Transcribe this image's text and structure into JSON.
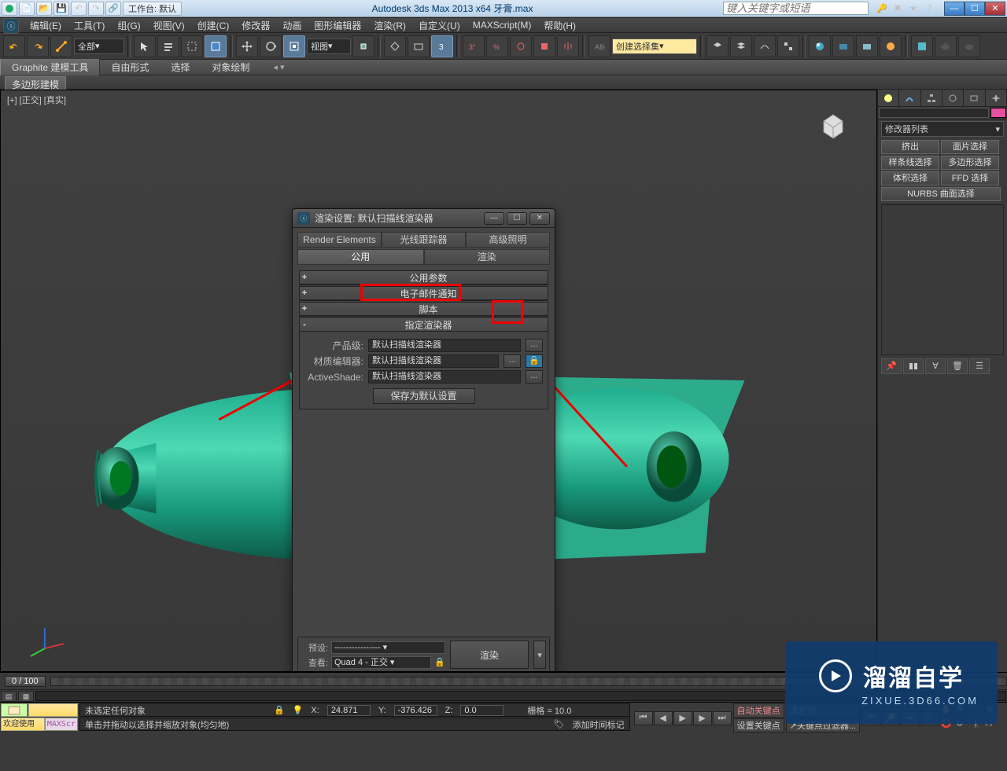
{
  "title": "Autodesk 3ds Max  2013 x64    牙膏.max",
  "search_placeholder": "键入关键字或短语",
  "workspace_label": "工作台: 默认",
  "menus": [
    "编辑(E)",
    "工具(T)",
    "组(G)",
    "视图(V)",
    "创建(C)",
    "修改器",
    "动画",
    "图形编辑器",
    "渲染(R)",
    "自定义(U)",
    "MAXScript(M)",
    "帮助(H)"
  ],
  "toolbar": {
    "selection_filter": "全部",
    "coord_label": "视图",
    "named_set_placeholder": "创建选择集"
  },
  "ribbon": {
    "tabs": [
      "Graphite 建模工具",
      "自由形式",
      "选择",
      "对象绘制"
    ],
    "sub": "多边形建模"
  },
  "viewport_label": "[+] [正交] [真实]",
  "cmdpanel": {
    "modlist": "修改器列表",
    "buttons": [
      "挤出",
      "面片选择",
      "样条线选择",
      "多边形选择",
      "体积选择",
      "FFD 选择"
    ],
    "nurbs": "NURBS 曲面选择"
  },
  "dialog": {
    "title": "渲染设置: 默认扫描线渲染器",
    "tabs_row1": [
      "Render Elements",
      "光线跟踪器",
      "高级照明"
    ],
    "tabs_row2": [
      "公用",
      "渲染"
    ],
    "rollups": [
      {
        "pm": "+",
        "title": "公用参数"
      },
      {
        "pm": "+",
        "title": "电子邮件通知"
      },
      {
        "pm": "+",
        "title": "脚本"
      },
      {
        "pm": "-",
        "title": "指定渲染器"
      }
    ],
    "rows": {
      "prod_label": "产品级:",
      "prod_value": "默认扫描线渲染器",
      "mat_label": "材质编辑器:",
      "mat_value": "默认扫描线渲染器",
      "as_label": "ActiveShade:",
      "as_value": "默认扫描线渲染器"
    },
    "save_btn": "保存为默认设置",
    "preset_label": "预设:",
    "preset_value": "----------------",
    "view_label": "查看:",
    "view_value": "Quad 4 - 正交",
    "render_btn": "渲染"
  },
  "timeline": {
    "slider": "0 / 100"
  },
  "status": {
    "welcome": "欢迎使用",
    "script": "MAXScr",
    "line1": "未选定任何对象",
    "x": "24.871",
    "y": "-376.426",
    "z": "0.0",
    "grid": "栅格 = 10.0",
    "line2": "单击并拖动以选择并缩放对象(均匀地)",
    "add_time": "添加时间标记",
    "autokey": "自动关键点",
    "setkey": "设置关键点",
    "selkey": "选定对",
    "keyfilter": "关键点过滤器..."
  },
  "watermark": {
    "text": "溜溜自学",
    "sub": "ZIXUE.3D66.COM"
  }
}
